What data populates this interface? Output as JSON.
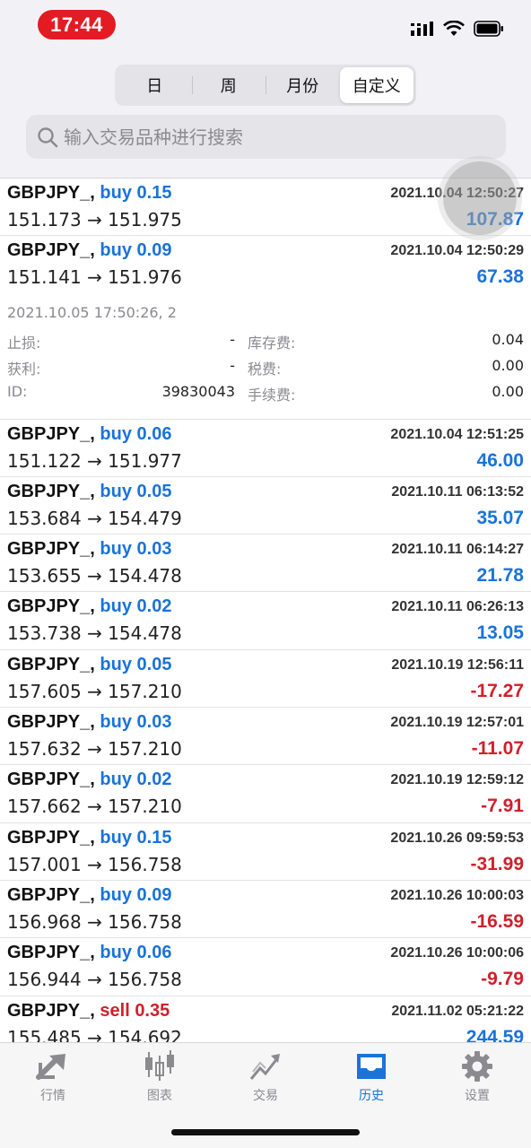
{
  "status_bar": {
    "time": "17:44"
  },
  "segments": [
    "日",
    "周",
    "月份",
    "自定义"
  ],
  "search": {
    "placeholder": "输入交易品种进行搜索"
  },
  "trades": [
    {
      "symbol": "GBPJPY_,",
      "side": "buy",
      "volume": "0.15",
      "datetime": "2021.10.04 12:50:27",
      "prices": "151.173 → 151.975",
      "profit": "107.87",
      "positive": true
    },
    {
      "symbol": "GBPJPY_,",
      "side": "buy",
      "volume": "0.09",
      "datetime": "2021.10.04 12:50:29",
      "prices": "151.141 → 151.976",
      "profit": "67.38",
      "positive": true
    },
    {
      "symbol": "GBPJPY_,",
      "side": "buy",
      "volume": "0.06",
      "datetime": "2021.10.04 12:51:25",
      "prices": "151.122 → 151.977",
      "profit": "46.00",
      "positive": true
    },
    {
      "symbol": "GBPJPY_,",
      "side": "buy",
      "volume": "0.05",
      "datetime": "2021.10.11 06:13:52",
      "prices": "153.684 → 154.479",
      "profit": "35.07",
      "positive": true
    },
    {
      "symbol": "GBPJPY_,",
      "side": "buy",
      "volume": "0.03",
      "datetime": "2021.10.11 06:14:27",
      "prices": "153.655 → 154.478",
      "profit": "21.78",
      "positive": true
    },
    {
      "symbol": "GBPJPY_,",
      "side": "buy",
      "volume": "0.02",
      "datetime": "2021.10.11 06:26:13",
      "prices": "153.738 → 154.478",
      "profit": "13.05",
      "positive": true
    },
    {
      "symbol": "GBPJPY_,",
      "side": "buy",
      "volume": "0.05",
      "datetime": "2021.10.19 12:56:11",
      "prices": "157.605 → 157.210",
      "profit": "-17.27",
      "positive": false
    },
    {
      "symbol": "GBPJPY_,",
      "side": "buy",
      "volume": "0.03",
      "datetime": "2021.10.19 12:57:01",
      "prices": "157.632 → 157.210",
      "profit": "-11.07",
      "positive": false
    },
    {
      "symbol": "GBPJPY_,",
      "side": "buy",
      "volume": "0.02",
      "datetime": "2021.10.19 12:59:12",
      "prices": "157.662 → 157.210",
      "profit": "-7.91",
      "positive": false
    },
    {
      "symbol": "GBPJPY_,",
      "side": "buy",
      "volume": "0.15",
      "datetime": "2021.10.26 09:59:53",
      "prices": "157.001 → 156.758",
      "profit": "-31.99",
      "positive": false
    },
    {
      "symbol": "GBPJPY_,",
      "side": "buy",
      "volume": "0.09",
      "datetime": "2021.10.26 10:00:03",
      "prices": "156.968 → 156.758",
      "profit": "-16.59",
      "positive": false
    },
    {
      "symbol": "GBPJPY_,",
      "side": "buy",
      "volume": "0.06",
      "datetime": "2021.10.26 10:00:06",
      "prices": "156.944 → 156.758",
      "profit": "-9.79",
      "positive": false
    },
    {
      "symbol": "GBPJPY_,",
      "side": "sell",
      "volume": "0.35",
      "datetime": "2021.11.02 05:21:22",
      "prices": "155.485 → 154.692",
      "profit": "244.59",
      "positive": true
    }
  ],
  "detail": {
    "opened": "2021.10.05 17:50:26, 2",
    "stop_loss_label": "止损:",
    "stop_loss": "-",
    "take_profit_label": "获利:",
    "take_profit": "-",
    "id_label": "ID:",
    "id": "39830043",
    "swap_label": "库存费:",
    "swap": "0.04",
    "taxes_label": "税费:",
    "taxes": "0.00",
    "commission_label": "手续费:",
    "commission": "0.00"
  },
  "tabs": [
    {
      "label": "行情",
      "icon": "quotes-icon",
      "active": false
    },
    {
      "label": "图表",
      "icon": "chart-icon",
      "active": false
    },
    {
      "label": "交易",
      "icon": "trade-icon",
      "active": false
    },
    {
      "label": "历史",
      "icon": "history-icon",
      "active": true
    },
    {
      "label": "设置",
      "icon": "settings-icon",
      "active": false
    }
  ],
  "colors": {
    "positive": "#1a73d9",
    "negative": "#d0202a",
    "time_pill": "#e31b23",
    "active_tab": "#1a73d9"
  }
}
